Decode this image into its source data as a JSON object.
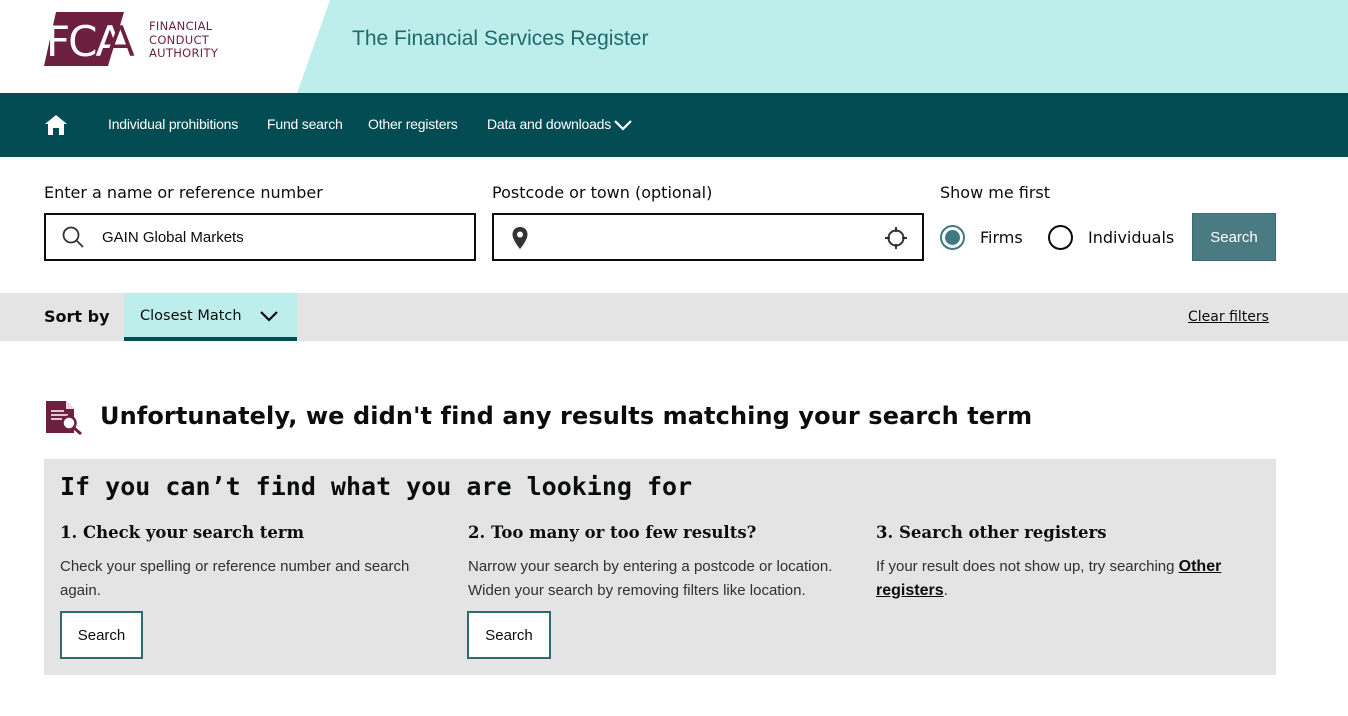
{
  "header": {
    "logo_mark": "FCA",
    "logo_lines": [
      "FINANCIAL",
      "CONDUCT",
      "AUTHORITY"
    ],
    "site_title": "The Financial Services Register"
  },
  "nav": {
    "home_icon": "home-icon",
    "items": [
      {
        "label": "Individual prohibitions"
      },
      {
        "label": "Fund search"
      },
      {
        "label": "Other registers"
      },
      {
        "label": "Data and downloads"
      }
    ]
  },
  "search": {
    "name_label": "Enter a name or reference number",
    "name_value": "GAIN Global Markets",
    "location_label": "Postcode or town (optional)",
    "location_value": "",
    "show_first_label": "Show me first",
    "options": [
      {
        "label": "Firms",
        "selected": true
      },
      {
        "label": "Individuals",
        "selected": false
      }
    ],
    "button_label": "Search"
  },
  "sort": {
    "label": "Sort by",
    "selected": "Closest Match",
    "clear_label": "Clear filters"
  },
  "results": {
    "no_results_title": "Unfortunately, we didn't find any results matching your search term"
  },
  "help": {
    "title": "If you can’t find what you are looking for",
    "columns": [
      {
        "title": "1. Check your search term",
        "text": "Check your spelling or reference number and search again.",
        "button": "Search"
      },
      {
        "title": "2. Too many or too few results?",
        "text": "Narrow your search by entering a postcode or location. Widen your search by removing filters like location.",
        "button": "Search"
      },
      {
        "title": "3. Search other registers",
        "text_before": "If your result does not show up, try searching ",
        "link": "Other registers",
        "text_after": "."
      }
    ]
  },
  "colors": {
    "brand_maroon": "#6d1f3f",
    "header_teal_light": "#bdeeeb",
    "nav_teal_dark": "#044c54",
    "button_teal": "#4a7b82",
    "panel_grey": "#e4e4e4"
  }
}
